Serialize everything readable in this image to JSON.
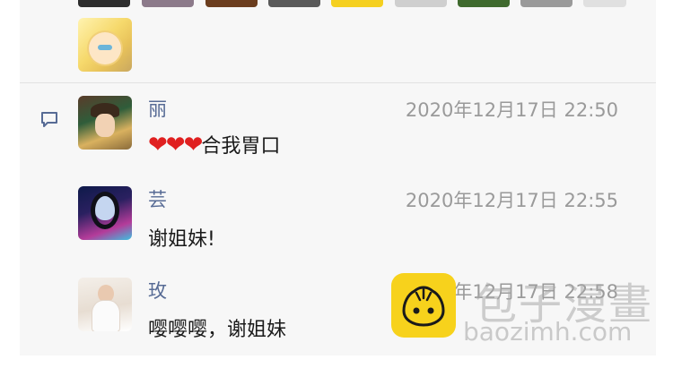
{
  "likes": {
    "top_row_colors": [
      "#2d2d2d",
      "#8c7a8a",
      "#6b3d1e",
      "#5a5a5a",
      "#f5d020",
      "#cfcfcf",
      "#3f6a2e",
      "#9a9a9a",
      "#e0e0e0"
    ],
    "icons": [
      "like-avatar"
    ]
  },
  "comment_icon": "comment-bubble-icon",
  "comments": [
    {
      "name": "丽",
      "time": "2020年12月17日 22:50",
      "hearts": "❤❤❤",
      "text": "合我胃口"
    },
    {
      "name": "芸",
      "time": "2020年12月17日 22:55",
      "text": "谢姐妹!"
    },
    {
      "name": "玫",
      "time": "2020年12月17日 22:58",
      "text": "嘤嘤嘤，谢姐妹"
    }
  ],
  "watermark": {
    "title": "包子漫畫",
    "url": "baozimh.com",
    "logo_color": "#f7d21c"
  }
}
